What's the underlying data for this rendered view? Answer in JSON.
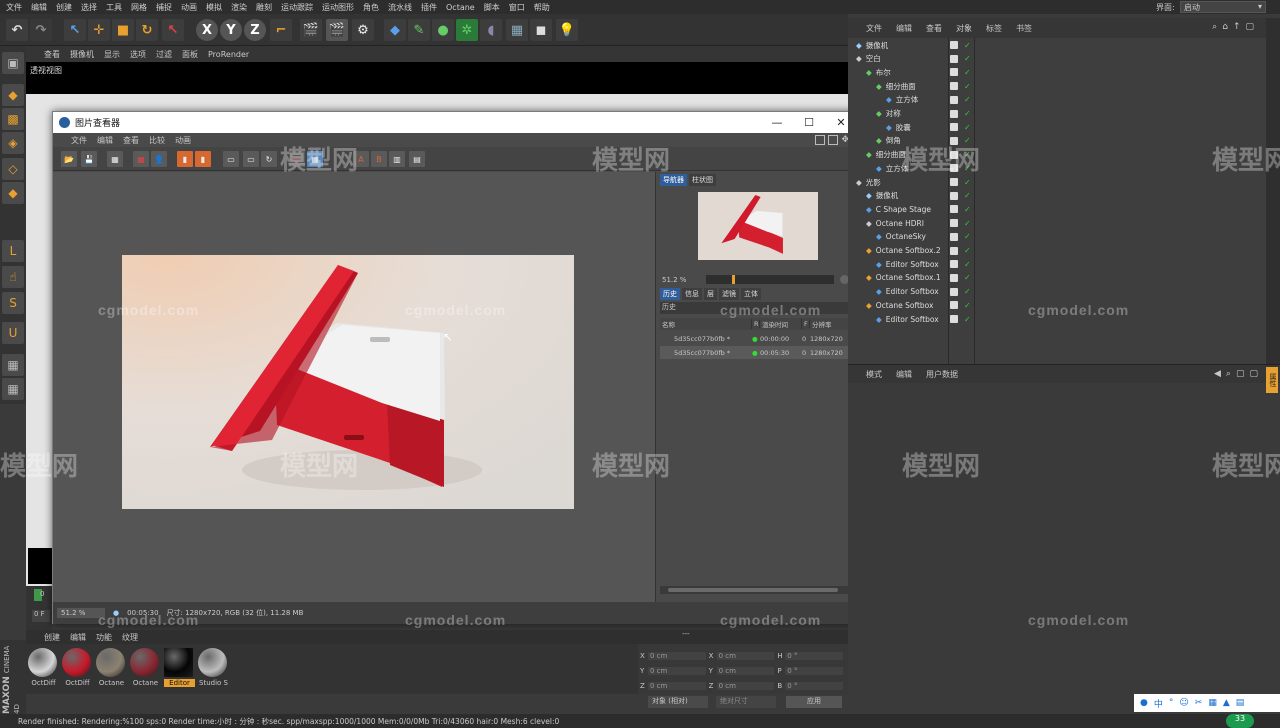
{
  "menu": [
    "文件",
    "编辑",
    "创建",
    "选择",
    "工具",
    "网格",
    "捕捉",
    "动画",
    "模拟",
    "渲染",
    "雕刻",
    "运动跟踪",
    "运动图形",
    "角色",
    "流水线",
    "插件",
    "Octane",
    "脚本",
    "窗口",
    "帮助"
  ],
  "interface": {
    "label": "界面:",
    "value": "启动"
  },
  "toolbar": {
    "x": "X",
    "y": "Y",
    "z": "Z"
  },
  "viewport": {
    "menu": [
      "查看",
      "摄像机",
      "显示",
      "选项",
      "过滤",
      "面板",
      "ProRender"
    ],
    "label": "透视视图",
    "frame_zero": "0",
    "frame_end": "0 F"
  },
  "picture_viewer": {
    "title": "图片查看器",
    "menu": [
      "文件",
      "编辑",
      "查看",
      "比较",
      "动画"
    ],
    "nav_tabs": [
      "导航器",
      "柱状图"
    ],
    "zoom": "51.2 %",
    "history_tabs": [
      "历史",
      "信息",
      "层",
      "滤镜",
      "立体"
    ],
    "history_label": "历史",
    "columns": [
      "名称",
      "R",
      "渲染时间",
      "F",
      "分辨率"
    ],
    "rows": [
      {
        "name": "5d35cc077b0fb *",
        "time": "00:00:00",
        "f": "0",
        "res": "1280x720"
      },
      {
        "name": "5d35cc077b0fb *",
        "time": "00:05:30",
        "f": "0",
        "res": "1280x720"
      }
    ],
    "status": {
      "zoom": "51.2 %",
      "time": "00:05:30",
      "info": "尺寸: 1280x720, RGB (32 位), 11.28 MB"
    },
    "win": {
      "min": "—",
      "max": "☐",
      "close": "✕"
    }
  },
  "object_manager": {
    "menu": [
      "文件",
      "编辑",
      "查看",
      "对象",
      "标签",
      "书签"
    ],
    "items": [
      {
        "label": "摄像机",
        "indent": 0
      },
      {
        "label": "空白",
        "indent": 0
      },
      {
        "label": "布尔",
        "indent": 1
      },
      {
        "label": "细分曲面",
        "indent": 2
      },
      {
        "label": "立方体",
        "indent": 3
      },
      {
        "label": "对称",
        "indent": 2
      },
      {
        "label": "胶囊",
        "indent": 3
      },
      {
        "label": "倒角",
        "indent": 2
      },
      {
        "label": "细分曲面",
        "indent": 1
      },
      {
        "label": "立方体",
        "indent": 2
      },
      {
        "label": "光影",
        "indent": 0
      },
      {
        "label": "摄像机",
        "indent": 1
      },
      {
        "label": "C Shape Stage",
        "indent": 1
      },
      {
        "label": "Octane HDRI",
        "indent": 1
      },
      {
        "label": "OctaneSky",
        "indent": 2
      },
      {
        "label": "Octane Softbox.2",
        "indent": 1
      },
      {
        "label": "Editor Softbox",
        "indent": 2
      },
      {
        "label": "Octane Softbox.1",
        "indent": 1
      },
      {
        "label": "Editor Softbox",
        "indent": 2
      },
      {
        "label": "Octane Softbox",
        "indent": 1
      },
      {
        "label": "Editor Softbox",
        "indent": 2
      }
    ]
  },
  "attributes": {
    "menu": [
      "模式",
      "编辑",
      "用户数据"
    ],
    "side_tab": "属性"
  },
  "materials": {
    "menu": [
      "创建",
      "编辑",
      "功能",
      "纹理"
    ],
    "items": [
      {
        "label": "OctDiff",
        "color": "#d6d6d6"
      },
      {
        "label": "OctDiff",
        "color": "#c8182a"
      },
      {
        "label": "Octane",
        "color": "#8c8270"
      },
      {
        "label": "Octane",
        "color": "#8a2530"
      },
      {
        "label": "Editor",
        "color": "#050505"
      },
      {
        "label": "Studio S",
        "color": "#bdbdbd"
      }
    ]
  },
  "coords": {
    "rows": [
      [
        "X",
        "0 cm",
        "X",
        "0 cm",
        "H",
        "0 °"
      ],
      [
        "Y",
        "0 cm",
        "Y",
        "0 cm",
        "P",
        "0 °"
      ],
      [
        "Z",
        "0 cm",
        "Z",
        "0 cm",
        "B",
        "0 °"
      ]
    ],
    "mode": "对象 (相对)",
    "size": "绝对尺寸",
    "apply": "应用",
    "header": "---"
  },
  "bottom_status": "Render finished: Rendering:%100 sps:0 Render time:小时 : 分钟 : 秒sec. spp/maxspp:1000/1000 Mem:0/0/0Mb Tri:0/43060 hair:0 Mesh:6 clevel:0",
  "brand": {
    "line1": "MAXON",
    "line2": "CINEMA 4D"
  },
  "tray_badge": "33",
  "watermarks": {
    "small": "cgmodel.com",
    "big": "模型网"
  }
}
